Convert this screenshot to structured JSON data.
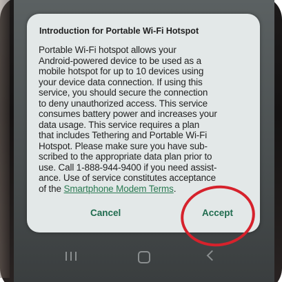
{
  "dialog": {
    "title": "Introduction for Portable Wi-Fi Hotspot",
    "body_lines": [
      "Portable Wi-Fi hotspot allows your",
      "Android-powered device to be used as a",
      "mobile hotspot for up to 10 devices using",
      "your device data connection. If using this",
      "service, you should secure the connection",
      "to deny unauthorized access. This service",
      "consumes battery power and increases your",
      "data usage. This service requires a plan",
      "that includes Tethering and Portable Wi-Fi",
      "Hotspot. Please make sure you have sub-",
      "scribed to the appropriate data plan prior to",
      "use. Call 1-888-944-9400 if you need assist-",
      "ance. Use of service constitutes acceptance"
    ],
    "last_line_prefix": "of the ",
    "terms_link": "Smartphone Modem Terms",
    "last_line_suffix": ".",
    "cancel_label": "Cancel",
    "accept_label": "Accept"
  },
  "colors": {
    "dialog_background": "#e3e8e8",
    "button_text": "#1f6b4e",
    "link": "#2a7a52",
    "annotation_circle": "#d6222c"
  },
  "nav": {
    "icons": [
      "recents-icon",
      "home-icon",
      "back-icon"
    ]
  }
}
